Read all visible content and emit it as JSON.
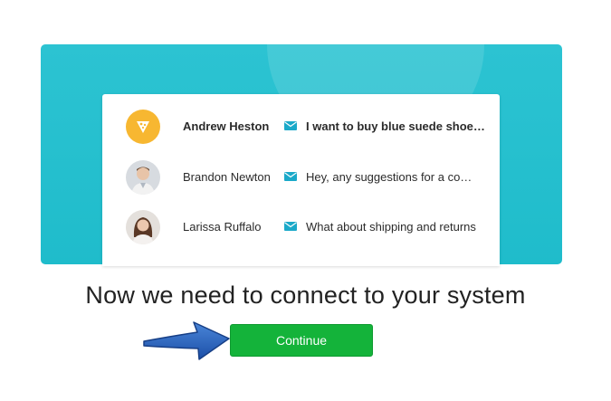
{
  "colors": {
    "accent": "#1fbccb",
    "button": "#14b33a",
    "mail_icon": "#1aa9c9"
  },
  "messages": [
    {
      "name": "Andrew Heston",
      "text": "I want to buy blue suede shoe…",
      "unread": true,
      "avatar_icon": "pizza-icon"
    },
    {
      "name": "Brandon Newton",
      "text": "Hey, any suggestions for a co…",
      "unread": false,
      "avatar_icon": "man-avatar"
    },
    {
      "name": "Larissa Ruffalo",
      "text": "What about shipping and returns",
      "unread": false,
      "avatar_icon": "woman-avatar"
    }
  ],
  "headline": "Now we need to connect to your system",
  "continue_label": "Continue"
}
